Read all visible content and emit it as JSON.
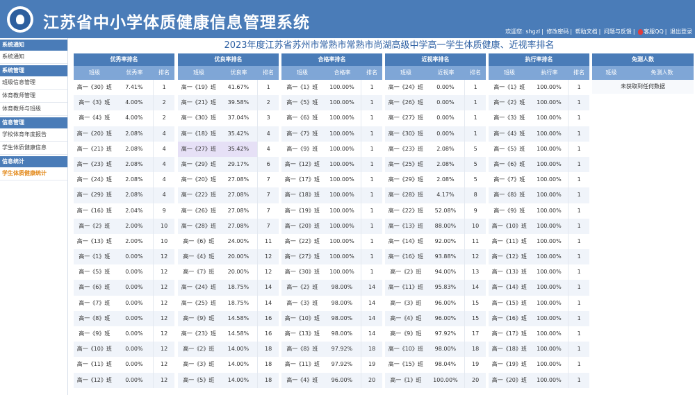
{
  "header": {
    "title": "江苏省中小学体质健康信息管理系统",
    "links": [
      "欢迎您: shgzl",
      "修改密码",
      "帮助文档",
      "问题与反馈",
      "客服QQ",
      "退出登录"
    ],
    "bg_color": "#4a7cb8"
  },
  "sidebar": {
    "sections": [
      {
        "title": "系统通知",
        "items": [
          "系统通知"
        ]
      },
      {
        "title": "系统管理",
        "items": [
          "班级信息管理",
          "体育教师管理",
          "体育教师与班级"
        ]
      },
      {
        "title": "信息管理",
        "items": [
          "学校体育年度报告",
          "学生体质健康信息"
        ]
      },
      {
        "title": "信息统计",
        "items": [
          "学生体质健康统计"
        ]
      }
    ],
    "active_item": "学生体质健康统计",
    "active_color": "#e38a1c"
  },
  "page_title": "2023年度江苏省苏州市常熟市常熟市尚湖高级中学高一学生体质健康、近视率排名",
  "tables": [
    {
      "title": "优秀率排名",
      "cols": [
        "班级",
        "优秀率",
        "排名"
      ],
      "highlight_row": -1,
      "rows": [
        [
          "高一《30》班",
          "7.41%",
          "1"
        ],
        [
          "高一《3》班",
          "4.00%",
          "2"
        ],
        [
          "高一《4》班",
          "4.00%",
          "2"
        ],
        [
          "高一《20》班",
          "2.08%",
          "4"
        ],
        [
          "高一《21》班",
          "2.08%",
          "4"
        ],
        [
          "高一《23》班",
          "2.08%",
          "4"
        ],
        [
          "高一《24》班",
          "2.08%",
          "4"
        ],
        [
          "高一《29》班",
          "2.08%",
          "4"
        ],
        [
          "高一《16》班",
          "2.04%",
          "9"
        ],
        [
          "高一《2》班",
          "2.00%",
          "10"
        ],
        [
          "高一《13》班",
          "2.00%",
          "10"
        ],
        [
          "高一《1》班",
          "0.00%",
          "12"
        ],
        [
          "高一《5》班",
          "0.00%",
          "12"
        ],
        [
          "高一《6》班",
          "0.00%",
          "12"
        ],
        [
          "高一《7》班",
          "0.00%",
          "12"
        ],
        [
          "高一《8》班",
          "0.00%",
          "12"
        ],
        [
          "高一《9》班",
          "0.00%",
          "12"
        ],
        [
          "高一《10》班",
          "0.00%",
          "12"
        ],
        [
          "高一《11》班",
          "0.00%",
          "12"
        ],
        [
          "高一《12》班",
          "0.00%",
          "12"
        ]
      ]
    },
    {
      "title": "优良率排名",
      "cols": [
        "班级",
        "优良率",
        "排名"
      ],
      "highlight_row": 4,
      "rows": [
        [
          "高一《19》班",
          "41.67%",
          "1"
        ],
        [
          "高一《21》班",
          "39.58%",
          "2"
        ],
        [
          "高一《30》班",
          "37.04%",
          "3"
        ],
        [
          "高一《18》班",
          "35.42%",
          "4"
        ],
        [
          "高一《27》班",
          "35.42%",
          "4"
        ],
        [
          "高一《29》班",
          "29.17%",
          "6"
        ],
        [
          "高一《20》班",
          "27.08%",
          "7"
        ],
        [
          "高一《22》班",
          "27.08%",
          "7"
        ],
        [
          "高一《26》班",
          "27.08%",
          "7"
        ],
        [
          "高一《28》班",
          "27.08%",
          "7"
        ],
        [
          "高一《6》班",
          "24.00%",
          "11"
        ],
        [
          "高一《4》班",
          "20.00%",
          "12"
        ],
        [
          "高一《7》班",
          "20.00%",
          "12"
        ],
        [
          "高一《24》班",
          "18.75%",
          "14"
        ],
        [
          "高一《25》班",
          "18.75%",
          "14"
        ],
        [
          "高一《9》班",
          "14.58%",
          "16"
        ],
        [
          "高一《23》班",
          "14.58%",
          "16"
        ],
        [
          "高一《2》班",
          "14.00%",
          "18"
        ],
        [
          "高一《3》班",
          "14.00%",
          "18"
        ],
        [
          "高一《5》班",
          "14.00%",
          "18"
        ]
      ]
    },
    {
      "title": "合格率排名",
      "cols": [
        "班级",
        "合格率",
        "排名"
      ],
      "highlight_row": -1,
      "rows": [
        [
          "高一《1》班",
          "100.00%",
          "1"
        ],
        [
          "高一《5》班",
          "100.00%",
          "1"
        ],
        [
          "高一《6》班",
          "100.00%",
          "1"
        ],
        [
          "高一《7》班",
          "100.00%",
          "1"
        ],
        [
          "高一《9》班",
          "100.00%",
          "1"
        ],
        [
          "高一《12》班",
          "100.00%",
          "1"
        ],
        [
          "高一《17》班",
          "100.00%",
          "1"
        ],
        [
          "高一《18》班",
          "100.00%",
          "1"
        ],
        [
          "高一《19》班",
          "100.00%",
          "1"
        ],
        [
          "高一《20》班",
          "100.00%",
          "1"
        ],
        [
          "高一《22》班",
          "100.00%",
          "1"
        ],
        [
          "高一《27》班",
          "100.00%",
          "1"
        ],
        [
          "高一《30》班",
          "100.00%",
          "1"
        ],
        [
          "高一《2》班",
          "98.00%",
          "14"
        ],
        [
          "高一《3》班",
          "98.00%",
          "14"
        ],
        [
          "高一《10》班",
          "98.00%",
          "14"
        ],
        [
          "高一《13》班",
          "98.00%",
          "14"
        ],
        [
          "高一《8》班",
          "97.92%",
          "18"
        ],
        [
          "高一《11》班",
          "97.92%",
          "19"
        ],
        [
          "高一《4》班",
          "96.00%",
          "20"
        ]
      ]
    },
    {
      "title": "近视率排名",
      "cols": [
        "班级",
        "近视率",
        "排名"
      ],
      "highlight_row": -1,
      "rows": [
        [
          "高一《24》班",
          "0.00%",
          "1"
        ],
        [
          "高一《26》班",
          "0.00%",
          "1"
        ],
        [
          "高一《27》班",
          "0.00%",
          "1"
        ],
        [
          "高一《30》班",
          "0.00%",
          "1"
        ],
        [
          "高一《23》班",
          "2.08%",
          "5"
        ],
        [
          "高一《25》班",
          "2.08%",
          "5"
        ],
        [
          "高一《29》班",
          "2.08%",
          "5"
        ],
        [
          "高一《28》班",
          "4.17%",
          "8"
        ],
        [
          "高一《22》班",
          "52.08%",
          "9"
        ],
        [
          "高一《13》班",
          "88.00%",
          "10"
        ],
        [
          "高一《14》班",
          "92.00%",
          "11"
        ],
        [
          "高一《16》班",
          "93.88%",
          "12"
        ],
        [
          "高一《2》班",
          "94.00%",
          "13"
        ],
        [
          "高一《11》班",
          "95.83%",
          "14"
        ],
        [
          "高一《3》班",
          "96.00%",
          "15"
        ],
        [
          "高一《4》班",
          "96.00%",
          "15"
        ],
        [
          "高一《9》班",
          "97.92%",
          "17"
        ],
        [
          "高一《10》班",
          "98.00%",
          "18"
        ],
        [
          "高一《15》班",
          "98.04%",
          "19"
        ],
        [
          "高一《1》班",
          "100.00%",
          "20"
        ]
      ]
    },
    {
      "title": "执行率排名",
      "cols": [
        "班级",
        "执行率",
        "排名"
      ],
      "highlight_row": -1,
      "rows": [
        [
          "高一《1》班",
          "100.00%",
          "1"
        ],
        [
          "高一《2》班",
          "100.00%",
          "1"
        ],
        [
          "高一《3》班",
          "100.00%",
          "1"
        ],
        [
          "高一《4》班",
          "100.00%",
          "1"
        ],
        [
          "高一《5》班",
          "100.00%",
          "1"
        ],
        [
          "高一《6》班",
          "100.00%",
          "1"
        ],
        [
          "高一《7》班",
          "100.00%",
          "1"
        ],
        [
          "高一《8》班",
          "100.00%",
          "1"
        ],
        [
          "高一《9》班",
          "100.00%",
          "1"
        ],
        [
          "高一《10》班",
          "100.00%",
          "1"
        ],
        [
          "高一《11》班",
          "100.00%",
          "1"
        ],
        [
          "高一《12》班",
          "100.00%",
          "1"
        ],
        [
          "高一《13》班",
          "100.00%",
          "1"
        ],
        [
          "高一《14》班",
          "100.00%",
          "1"
        ],
        [
          "高一《15》班",
          "100.00%",
          "1"
        ],
        [
          "高一《16》班",
          "100.00%",
          "1"
        ],
        [
          "高一《17》班",
          "100.00%",
          "1"
        ],
        [
          "高一《18》班",
          "100.00%",
          "1"
        ],
        [
          "高一《19》班",
          "100.00%",
          "1"
        ],
        [
          "高一《20》班",
          "100.00%",
          "1"
        ]
      ]
    }
  ],
  "exempt": {
    "title": "免测人数",
    "cols": [
      "班级",
      "免测人数"
    ],
    "empty_msg": "未获取到任何数据"
  }
}
